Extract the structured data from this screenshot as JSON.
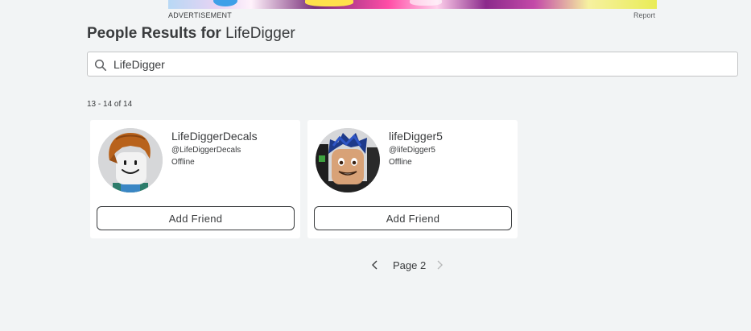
{
  "ad": {
    "label": "ADVERTISEMENT",
    "report": "Report"
  },
  "title": {
    "prefix": "People Results for",
    "query": "LifeDigger"
  },
  "search": {
    "value": "LifeDigger",
    "icon": "search-icon"
  },
  "results_count": "13 - 14 of 14",
  "cards": [
    {
      "name": "LifeDiggerDecals",
      "handle": "@LifeDiggerDecals",
      "status": "Offline",
      "button": "Add Friend"
    },
    {
      "name": "lifeDigger5",
      "handle": "@lifeDigger5",
      "status": "Offline",
      "button": "Add Friend"
    }
  ],
  "pager": {
    "label": "Page 2",
    "prev_icon": "chevron-left-icon",
    "next_icon": "chevron-right-icon"
  },
  "colors": {
    "background": "#f2f4f5",
    "card": "#ffffff",
    "text": "#393b3d"
  }
}
